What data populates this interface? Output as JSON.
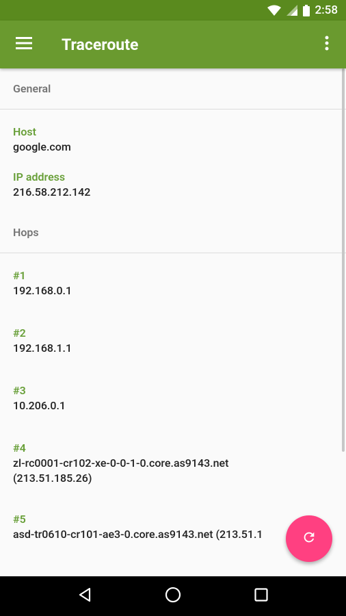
{
  "status_bar": {
    "time": "2:58"
  },
  "app_bar": {
    "title": "Traceroute"
  },
  "general": {
    "header": "General",
    "host_label": "Host",
    "host_value": "google.com",
    "ip_label": "IP address",
    "ip_value": "216.58.212.142"
  },
  "hops": {
    "header": "Hops",
    "items": [
      {
        "label": "#1",
        "value": "192.168.0.1"
      },
      {
        "label": "#2",
        "value": "192.168.1.1"
      },
      {
        "label": "#3",
        "value": "10.206.0.1"
      },
      {
        "label": "#4",
        "value": "zl-rc0001-cr102-xe-0-0-1-0.core.as9143.net (213.51.185.26)"
      },
      {
        "label": "#5",
        "value": "asd-tr0610-cr101-ae3-0.core.as9143.net (213.51.1"
      }
    ]
  },
  "colors": {
    "status_bar": "#5a8a1e",
    "app_bar": "#6a9a2f",
    "accent_label": "#689f38",
    "fab": "#ff4081"
  },
  "icons": {
    "menu": "hamburger-menu-icon",
    "overflow": "more-vert-icon",
    "fab": "refresh-icon",
    "nav_back": "back-triangle-icon",
    "nav_home": "home-circle-icon",
    "nav_recents": "recents-square-icon"
  }
}
